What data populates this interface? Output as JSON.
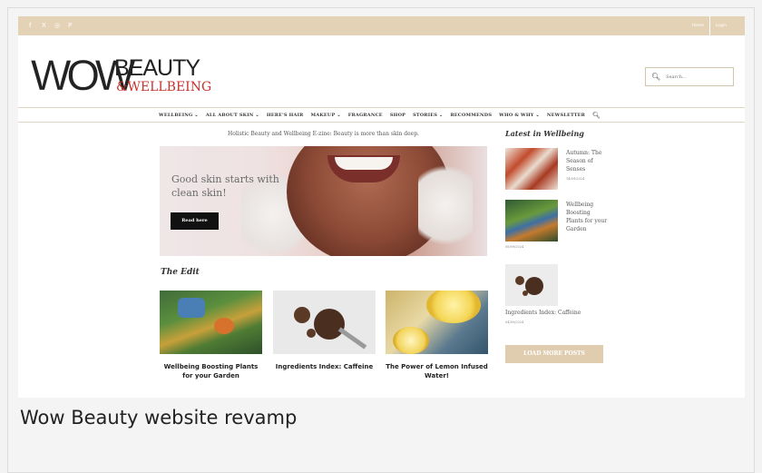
{
  "topbar": {
    "social_icons": [
      {
        "name": "facebook-icon",
        "glyph": "f"
      },
      {
        "name": "x-icon",
        "glyph": "X"
      },
      {
        "name": "instagram-icon",
        "glyph": "◎"
      },
      {
        "name": "pinterest-icon",
        "glyph": "P"
      }
    ],
    "links": [
      "Home",
      "Login"
    ]
  },
  "logo": {
    "wow": "WOW",
    "beauty": "BEAUTY",
    "wellbeing": "&WELLBEING"
  },
  "search": {
    "placeholder": "Search..."
  },
  "nav": {
    "items": [
      "WELLBEING ⌄",
      "ALL ABOUT SKIN ⌄",
      "HERE'S HAIR",
      "MAKEUP ⌄",
      "FRAGRANCE",
      "SHOP",
      "STORIES ⌄",
      "RECOMMENDS",
      "WHO & WHY ⌄",
      "NEWSLETTER"
    ]
  },
  "tagline": "Holistic Beauty and Wellbeing E-zine: Beauty is more than skin deep.",
  "hero": {
    "title": "Good skin starts with clean skin!",
    "button": "Read here"
  },
  "edit": {
    "heading": "The Edit",
    "cards": [
      {
        "title": "Wellbeing Boosting Plants for your Garden"
      },
      {
        "title": "Ingredients Index: Caffeine"
      },
      {
        "title": "The Power of Lemon Infused Water!"
      }
    ]
  },
  "sidebar": {
    "heading": "Latest in Wellbeing",
    "posts": [
      {
        "title": "Autumn: The Season of Senses",
        "date": "14/09/2024"
      },
      {
        "title": "Wellbeing Boosting Plants for your Garden",
        "date": "08/09/2024"
      },
      {
        "title": "Ingredients Index: Caffeine",
        "date": "04/09/2024"
      }
    ],
    "load_more": "LOAD MORE POSTS"
  },
  "caption": "Wow Beauty website revamp",
  "colors": {
    "accent_beige": "#e4d2b6",
    "logo_red": "#c8332d",
    "button_dark": "#111111"
  }
}
